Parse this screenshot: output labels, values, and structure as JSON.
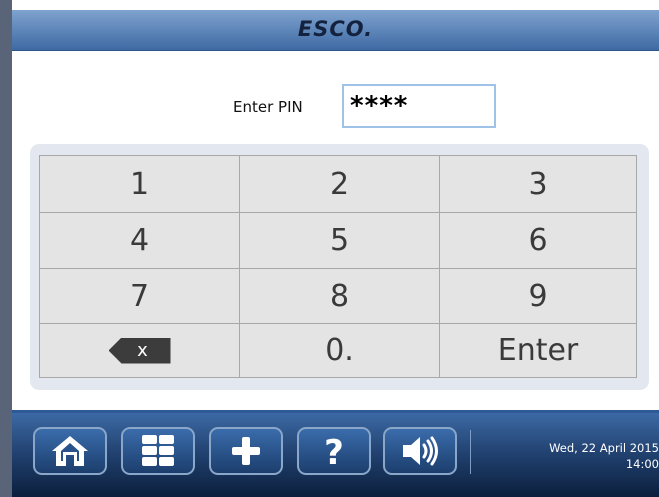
{
  "header": {
    "logo_text": "ESCO."
  },
  "pin": {
    "label": "Enter PIN",
    "value": "****"
  },
  "keypad": {
    "keys": [
      "1",
      "2",
      "3",
      "4",
      "5",
      "6",
      "7",
      "8",
      "9",
      "0.",
      "Enter"
    ],
    "backspace_label": "x"
  },
  "toolbar": {
    "buttons": [
      "home-icon",
      "grid-menu-icon",
      "plus-icon",
      "question-icon",
      "speaker-icon"
    ]
  },
  "status": {
    "date": "Wed, 22 April 2015",
    "time": "14:00"
  },
  "colors": {
    "header": "#3e6aa3",
    "footer": "#20406e",
    "keypad_bg": "#e3e8f0",
    "key_bg": "#e4e4e4",
    "pin_border": "#9ec3e6"
  }
}
